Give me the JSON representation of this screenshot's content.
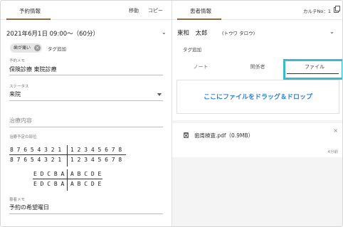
{
  "left": {
    "tab_label": "予約情報",
    "actions": {
      "move": "移動",
      "copy": "コピー"
    },
    "datetime": "2021年6月1日 09:00〜（60分）",
    "tags": [
      {
        "label": "歯が痛い"
      }
    ],
    "tag_add": "タグ追加",
    "memo": {
      "label": "予約メモ",
      "value": "保険診療 東院診療"
    },
    "status": {
      "label": "ステータス",
      "value": "来院"
    },
    "treatment": {
      "placeholder": "治療内容"
    },
    "teeth": {
      "label": "治療予定の部位",
      "upper_left": "8 7 6 5 4 3 2 1",
      "upper_right": "1 2 3 4 5 6 7 8",
      "lower_left": "8 7 6 5 4 3 2 1",
      "lower_right": "1 2 3 4 5 6 7 8",
      "baby_upper_left": "E D C B A",
      "baby_upper_right": "A B C D E",
      "baby_lower_left": "E D C B A",
      "baby_lower_right": "A B C D E"
    },
    "patient_memo": {
      "label": "患者メモ",
      "value": "予約の希望曜日"
    }
  },
  "right": {
    "tab_label": "患者情報",
    "karte": "カルテNo：1",
    "patient_name": "東和　太郎",
    "patient_kana": "(トウワ タロウ)",
    "tag_add": "タグ追加",
    "sub_tabs": [
      {
        "label": "ノート"
      },
      {
        "label": "関係者"
      },
      {
        "label": "ファイル"
      }
    ],
    "dropzone_text": "ここにファイルをドラッグ＆ドロップ",
    "file": {
      "name": "歯周検査.pdf（0.9MB）",
      "time": "4分前",
      "close": "×"
    }
  },
  "colors": {
    "accent": "#8c6a4a",
    "highlight": "#3bbac9",
    "link": "#2f7fd6"
  }
}
